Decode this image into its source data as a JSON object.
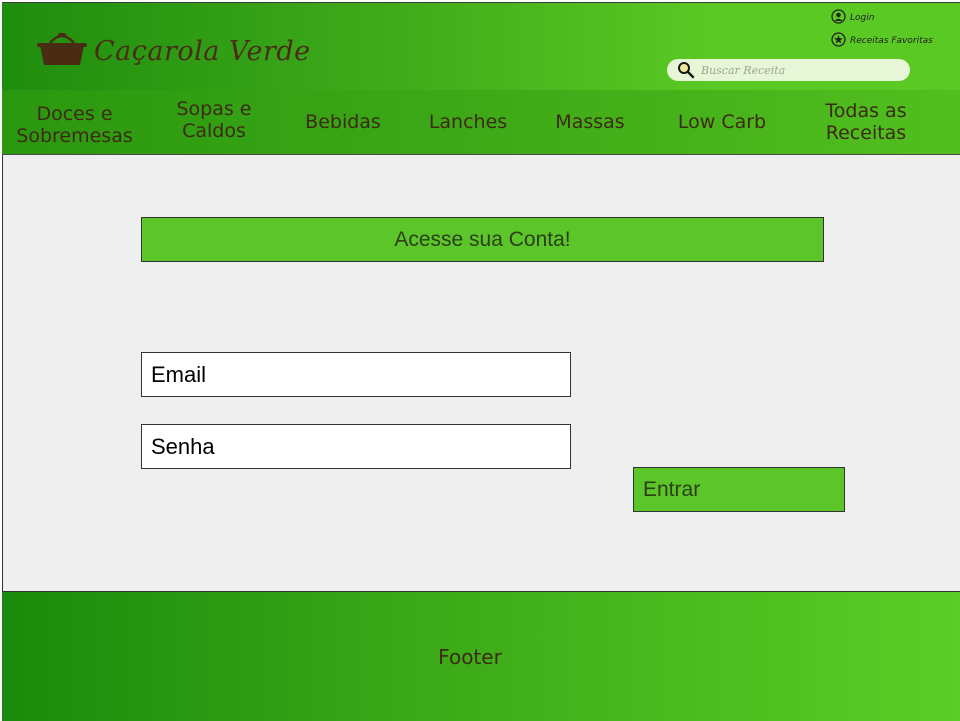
{
  "header": {
    "logo_text": "Caçarola Verde",
    "search_placeholder": "Buscar Receita",
    "login_label": "Login",
    "favorites_label": "Receitas Favoritas"
  },
  "nav": {
    "items": [
      {
        "lines": [
          "Doces e",
          "Sobremesas"
        ]
      },
      {
        "lines": [
          "Sopas e",
          "Caldos"
        ]
      },
      {
        "lines": [
          "Bebidas"
        ]
      },
      {
        "lines": [
          "Lanches"
        ]
      },
      {
        "lines": [
          "Massas"
        ]
      },
      {
        "lines": [
          "Low Carb"
        ]
      },
      {
        "lines": [
          "Todas as",
          "Receitas"
        ]
      }
    ]
  },
  "login_form": {
    "title": "Acesse sua Conta!",
    "email_placeholder": "Email",
    "password_placeholder": "Senha",
    "submit_label": "Entrar"
  },
  "footer": {
    "text": "Footer"
  },
  "colors": {
    "accent_green": "#5bc52a",
    "brown_text": "#3d2a12",
    "background": "#efefef"
  }
}
